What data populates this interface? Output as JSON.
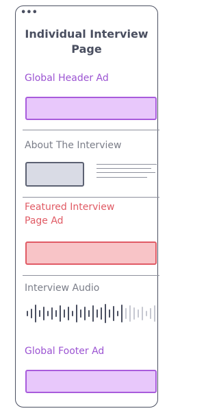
{
  "window": {
    "dots": "•••"
  },
  "title": [
    "Individual Interview",
    "Page"
  ],
  "sections": {
    "global_header_ad": "Global Header Ad",
    "about_the_interview": "About The Interview",
    "featured_interview_page_ad": [
      "Featured Interview",
      "Page Ad"
    ],
    "interview_audio": "Interview Audio",
    "global_footer_ad": "Global Footer Ad"
  },
  "colors": {
    "ad_purple": "#a85bdc",
    "ad_purple_fill": "#e8c8fb",
    "ad_red": "#e05a64",
    "ad_red_fill": "#f8c4c7",
    "outline": "#4a4f60",
    "muted": "#8d909c"
  }
}
